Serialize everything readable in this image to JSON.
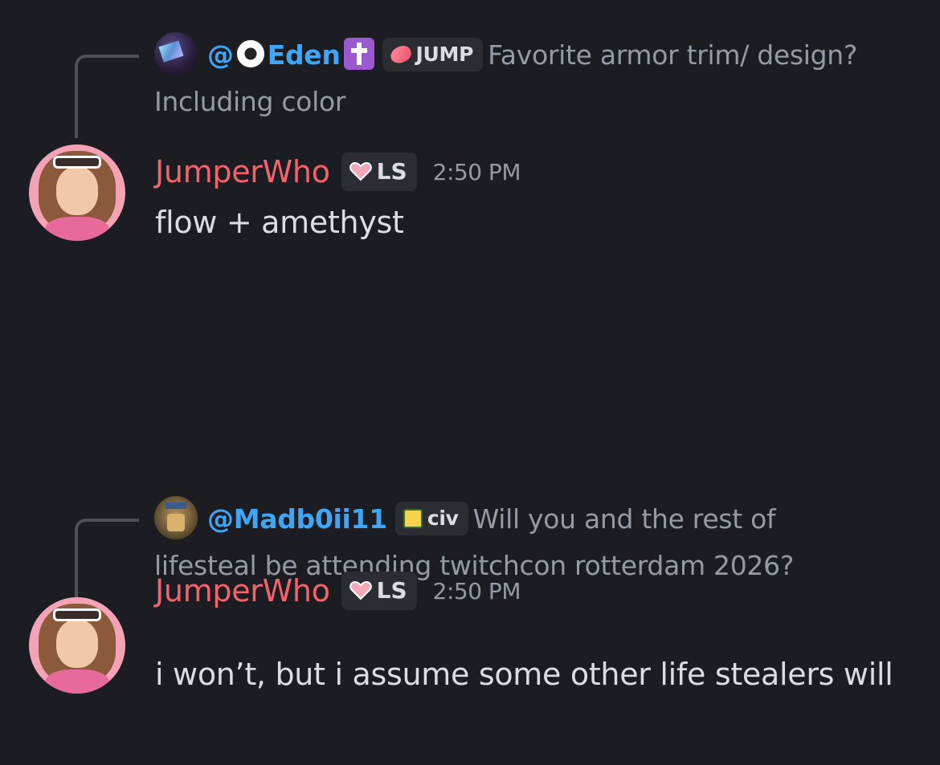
{
  "messages": [
    {
      "reply": {
        "mention": "@⚽Eden✝️",
        "mention_prefix": "@",
        "mention_name": "Eden",
        "tag_label": "JUMP",
        "text": "Favorite armor trim/ design? Including color"
      },
      "author": "JumperWho",
      "author_tag": "LS",
      "timestamp": "2:50 PM",
      "content": "flow + amethyst"
    },
    {
      "reply": {
        "mention": "@Madb0ii11",
        "tag_label": "civ",
        "text": "Will you and the rest of lifesteal be attending twitchcon rotterdam 2026?"
      },
      "author": "JumperWho",
      "author_tag": "LS",
      "timestamp": "2:50 PM",
      "content": "i won’t, but i assume some other life stealers will"
    }
  ],
  "colors": {
    "background": "#1c1d22",
    "username": "#f2636b",
    "mention": "#3fa5f5",
    "muted": "#949ba4",
    "text": "#dbdee1",
    "tag_bg": "#2b2d33"
  },
  "icons": {
    "reply_avatar_1": "reply-avatar-eden",
    "reply_avatar_2": "reply-avatar-madb",
    "jump_tag_icon": "pink-lips-icon",
    "ls_tag_icon": "pink-heart-icon",
    "civ_tag_icon": "crown-icon"
  }
}
